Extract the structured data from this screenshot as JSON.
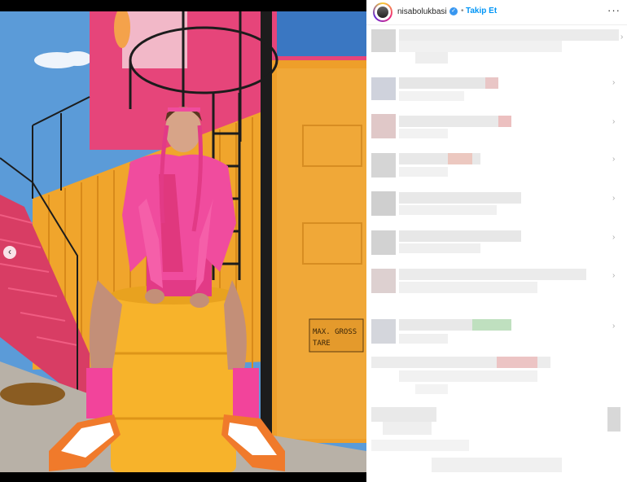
{
  "post": {
    "username": "nisabolukbasi",
    "verified_icon": "verified-badge-icon",
    "separator": "•",
    "follow_label": "Takip Et",
    "more_label": "···"
  },
  "media": {
    "prev_arrow": "‹",
    "sign_line1": "MAX. GROSS",
    "sign_line2": "TARE",
    "carousel_slides": 2,
    "carousel_active": 2
  },
  "colors": {
    "sky": "#6aa7d8",
    "container_orange": "#f0a52c",
    "pink_wall": "#e8467a",
    "jacket_pink": "#f04c9e",
    "barrel_yellow": "#f7b32b",
    "follow_blue": "#0095f6"
  }
}
